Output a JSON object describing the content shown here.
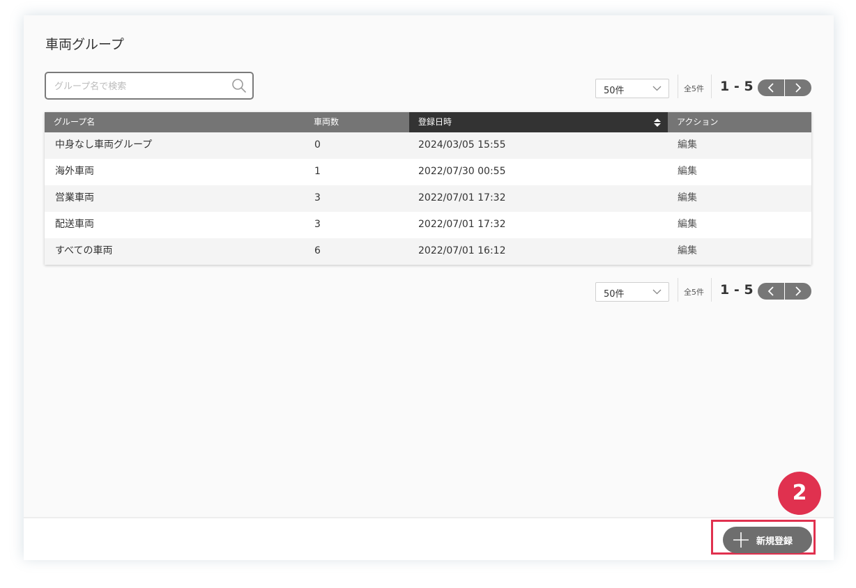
{
  "page": {
    "title": "車両グループ"
  },
  "search": {
    "placeholder": "グループ名で検索"
  },
  "pagination": {
    "per_page": "50件",
    "total": "全5件",
    "range": "1 - 5"
  },
  "table": {
    "columns": [
      "グループ名",
      "車両数",
      "登録日時",
      "アクション"
    ],
    "sorted_column": "登録日時",
    "rows": [
      {
        "name": "中身なし車両グループ",
        "count": "0",
        "date": "2024/03/05 15:55",
        "action": "編集"
      },
      {
        "name": "海外車両",
        "count": "1",
        "date": "2022/07/30 00:55",
        "action": "編集"
      },
      {
        "name": "営業車両",
        "count": "3",
        "date": "2022/07/01 17:32",
        "action": "編集"
      },
      {
        "name": "配送車両",
        "count": "3",
        "date": "2022/07/01 17:32",
        "action": "編集"
      },
      {
        "name": "すべての車両",
        "count": "6",
        "date": "2022/07/01 16:12",
        "action": "編集"
      }
    ]
  },
  "footer": {
    "register_label": "新規登録"
  },
  "step_badge": "2",
  "icons": {
    "search": "search-icon",
    "sort": "sort-icon",
    "prev": "chevron-left-icon",
    "next": "chevron-right-icon",
    "dropdown": "chevron-down-icon",
    "add": "plus-icon"
  },
  "colors": {
    "header_bg": "#757575",
    "header_sorted_bg": "#333333",
    "button_bg": "#6e6e6e",
    "highlight": "#e0314f"
  }
}
